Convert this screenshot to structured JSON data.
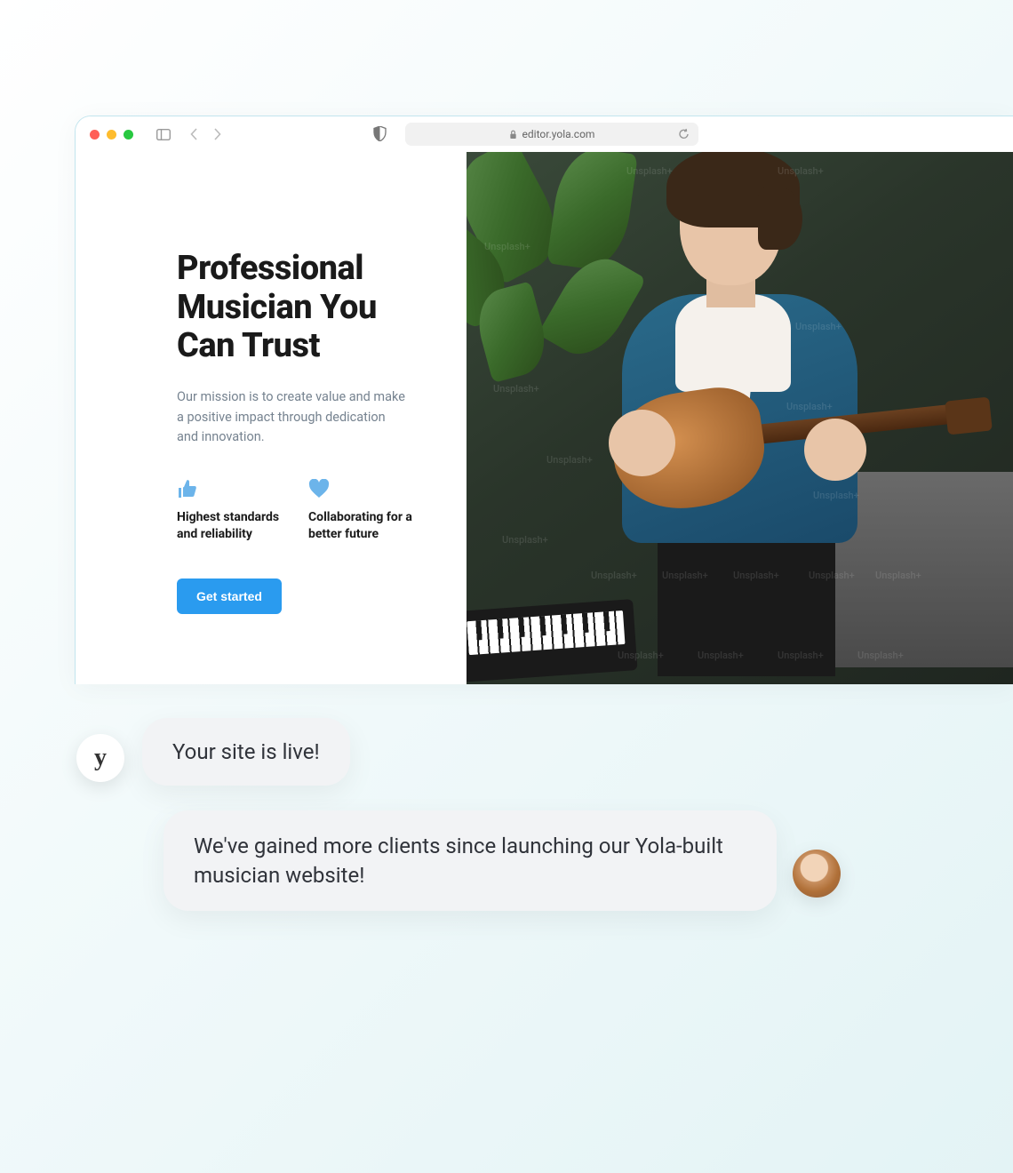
{
  "browser": {
    "url": "editor.yola.com"
  },
  "hero": {
    "headline": "Professional Musician You Can Trust",
    "mission": "Our mission is to create value and make a positive impact through dedication and innovation.",
    "features": [
      {
        "label": "Highest standards and reliability"
      },
      {
        "label": "Collaborating for a better future"
      }
    ],
    "cta_label": "Get started"
  },
  "chat": {
    "avatar_letter": "y",
    "bubble1": "Your site is live!",
    "bubble2": "We've gained more clients since launching our Yola-built musician website!"
  },
  "image_watermark": "Unsplash+"
}
